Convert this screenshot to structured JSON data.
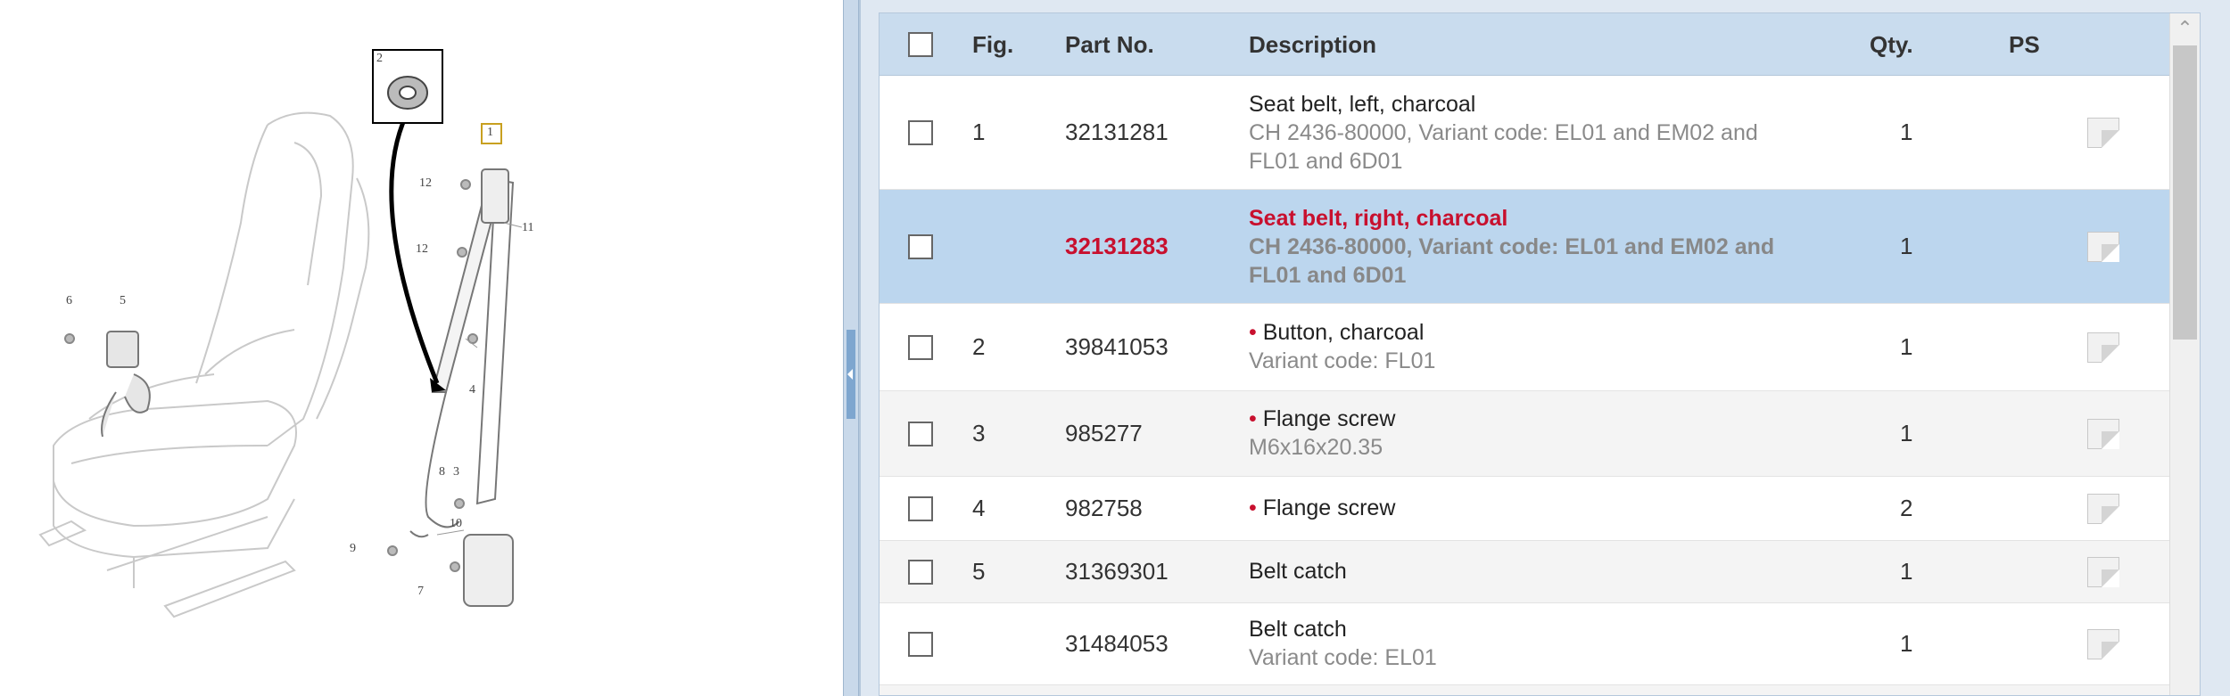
{
  "diagram": {
    "callouts": [
      "1",
      "2",
      "3",
      "4",
      "5",
      "6",
      "7",
      "8",
      "9",
      "10",
      "11",
      "12",
      "12"
    ]
  },
  "table": {
    "headers": {
      "fig": "Fig.",
      "part_no": "Part No.",
      "description": "Description",
      "qty": "Qty.",
      "ps": "PS"
    },
    "rows": [
      {
        "fig": "1",
        "part_no": "32131281",
        "bullet": "",
        "main": "Seat belt, left, charcoal",
        "sub": "CH 2436-80000, Variant code: EL01 and EM02 and FL01 and 6D01",
        "qty": "1"
      },
      {
        "fig": "",
        "part_no": "32131283",
        "bullet": "",
        "main": "Seat belt, right, charcoal",
        "sub": "CH 2436-80000, Variant code: EL01 and EM02 and FL01 and 6D01",
        "qty": "1"
      },
      {
        "fig": "2",
        "part_no": "39841053",
        "bullet": "•",
        "main": "Button, charcoal",
        "sub": "Variant code: FL01",
        "qty": "1"
      },
      {
        "fig": "3",
        "part_no": "985277",
        "bullet": "•",
        "main": "Flange screw",
        "sub": "M6x16x20.35",
        "qty": "1"
      },
      {
        "fig": "4",
        "part_no": "982758",
        "bullet": "•",
        "main": "Flange screw",
        "sub": "",
        "qty": "2"
      },
      {
        "fig": "5",
        "part_no": "31369301",
        "bullet": "",
        "main": "Belt catch",
        "sub": "",
        "qty": "1"
      },
      {
        "fig": "",
        "part_no": "31484053",
        "bullet": "",
        "main": "Belt catch",
        "sub": "Variant code: EL01",
        "qty": "1"
      }
    ]
  },
  "scrollbar": {
    "up_arrow": "⌃"
  },
  "colors": {
    "header_bg": "#c9dcee",
    "selected_bg": "#bcd6ee",
    "accent_red": "#c8102e"
  }
}
